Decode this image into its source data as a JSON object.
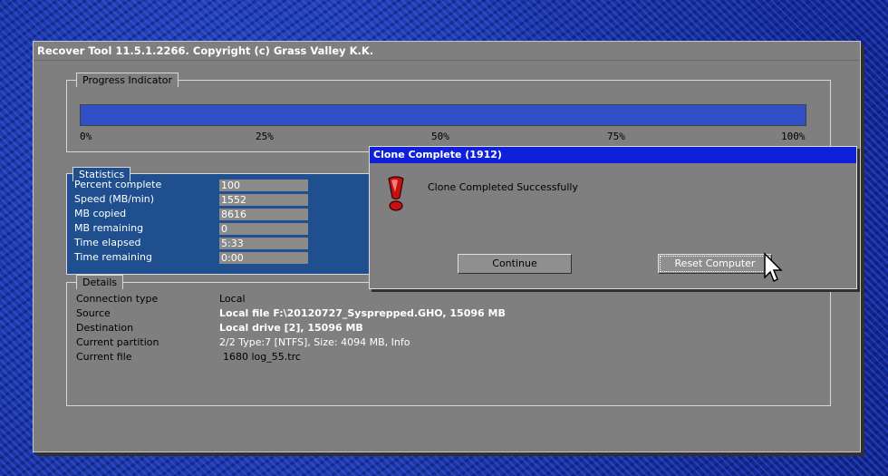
{
  "window": {
    "title": "Recover Tool 11.5.1.2266.  Copyright (c) Grass Valley K.K."
  },
  "progress": {
    "label": "Progress Indicator",
    "fraction": 1.0,
    "ticks": [
      "0%",
      "25%",
      "50%",
      "75%",
      "100%"
    ],
    "fill_color": "#3150c8"
  },
  "statistics": {
    "label": "Statistics",
    "rows": [
      {
        "label": "Percent complete",
        "value": "100"
      },
      {
        "label": "Speed (MB/min)",
        "value": "1552"
      },
      {
        "label": "MB copied",
        "value": "8616"
      },
      {
        "label": "MB remaining",
        "value": "0"
      },
      {
        "label": "Time elapsed",
        "value": "5:33"
      },
      {
        "label": "Time remaining",
        "value": "0:00"
      }
    ]
  },
  "details": {
    "label": "Details",
    "rows": [
      {
        "label": "Connection type",
        "value": "Local"
      },
      {
        "label": "Source",
        "value": "Local file F:\\20120727_Sysprepped.GHO, 15096 MB"
      },
      {
        "label": "Destination",
        "value": "Local drive [2], 15096 MB"
      },
      {
        "label": "Current partition",
        "value": "2/2 Type:7 [NTFS], Size: 4094 MB, Info"
      },
      {
        "label": "Current file",
        "value": "1680 log_55.trc"
      }
    ]
  },
  "dialog": {
    "title": "Clone Complete (1912)",
    "message": "Clone Completed Successfully",
    "icon": "exclamation-icon",
    "continue_label": "Continue",
    "reset_label": "Reset Computer",
    "title_color": "#1020d8"
  }
}
